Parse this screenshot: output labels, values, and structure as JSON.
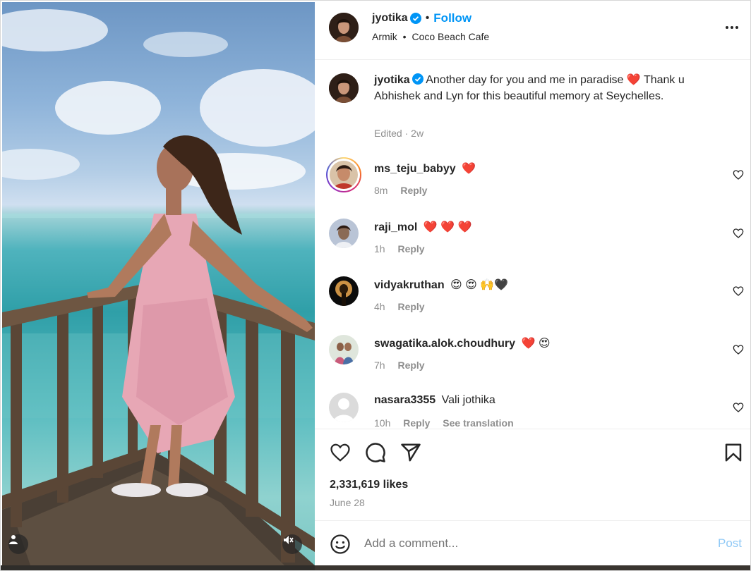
{
  "colors": {
    "link": "#0095f6",
    "text": "#262626",
    "muted": "#8e8e8e",
    "heart": "#ff3040",
    "post_disabled": "#90c9f6"
  },
  "header": {
    "username": "jyotika",
    "follow_label": "Follow",
    "location_artist": "Armik",
    "location_separator": "•",
    "location": "Coco Beach Cafe",
    "more_icon": "more-horizontal-icon"
  },
  "caption": {
    "username": "jyotika",
    "line1": "Another day for you and me in paradise ❤️",
    "line2": "Thank u Abhishek and Lyn for this beautiful memory at Seychelles.",
    "edited": "Edited",
    "separator": "·",
    "age": "2w"
  },
  "comments": [
    {
      "user": "ms_teju_babyy",
      "text": "❤️",
      "age": "8m",
      "reply": "Reply"
    },
    {
      "user": "raji_mol",
      "text": "❤️ ❤️ ❤️",
      "age": "1h",
      "reply": "Reply"
    },
    {
      "user": "vidyakruthan",
      "text": "😍 😍 🙌🖤",
      "age": "4h",
      "reply": "Reply"
    },
    {
      "user": "swagatika.alok.choudhury",
      "text": "❤️ 😍",
      "age": "7h",
      "reply": "Reply"
    },
    {
      "user": "nasara3355",
      "text": "Vali jothika",
      "age": "10h",
      "reply": "Reply",
      "translate": "See translation"
    }
  ],
  "actions": {
    "like_icon": "heart-icon",
    "comment_icon": "comment-icon",
    "share_icon": "share-icon",
    "save_icon": "bookmark-icon"
  },
  "likes": "2,331,619 likes",
  "date": "June 28",
  "add_comment": {
    "placeholder": "Add a comment...",
    "post_label": "Post"
  }
}
